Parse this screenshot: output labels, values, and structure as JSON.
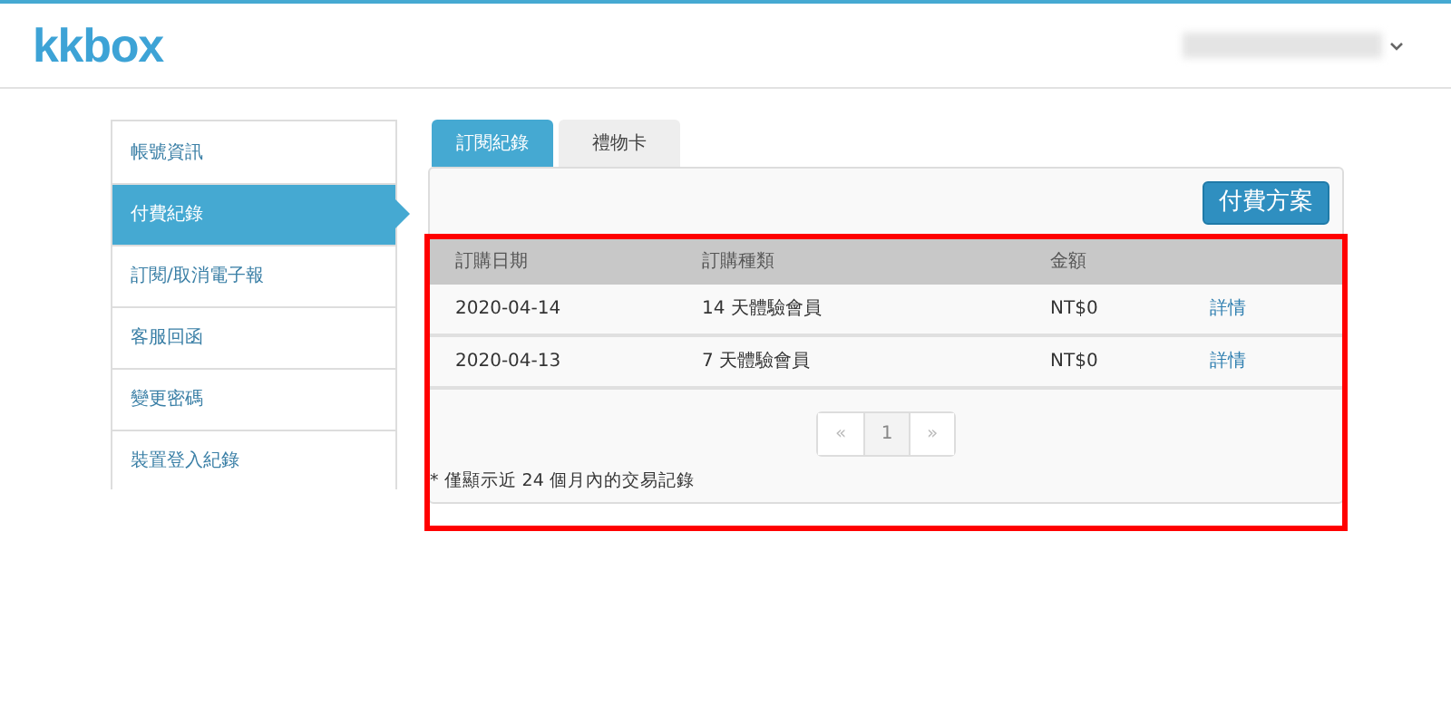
{
  "header": {
    "logo": "kkbox"
  },
  "sidebar": {
    "items": [
      {
        "label": "帳號資訊",
        "selected": false
      },
      {
        "label": "付費紀錄",
        "selected": true
      },
      {
        "label": "訂閱/取消電子報",
        "selected": false
      },
      {
        "label": "客服回函",
        "selected": false
      },
      {
        "label": "變更密碼",
        "selected": false
      },
      {
        "label": "裝置登入紀錄",
        "selected": false
      }
    ]
  },
  "tabs": [
    {
      "label": "訂閱紀錄",
      "selected": true
    },
    {
      "label": "禮物卡",
      "selected": false
    }
  ],
  "plan_button": "付費方案",
  "table": {
    "columns": [
      "訂購日期",
      "訂購種類",
      "金額"
    ],
    "rows": [
      {
        "date": "2020-04-14",
        "type": "14 天體驗會員",
        "amount": "NT$0",
        "link": "詳情"
      },
      {
        "date": "2020-04-13",
        "type": "7 天體驗會員",
        "amount": "NT$0",
        "link": "詳情"
      }
    ]
  },
  "pagination": [
    {
      "label": "«",
      "selected": false
    },
    {
      "label": "1",
      "selected": true
    },
    {
      "label": "»",
      "selected": false
    }
  ],
  "footnote": "* 僅顯示近 24 個月內的交易記錄"
}
